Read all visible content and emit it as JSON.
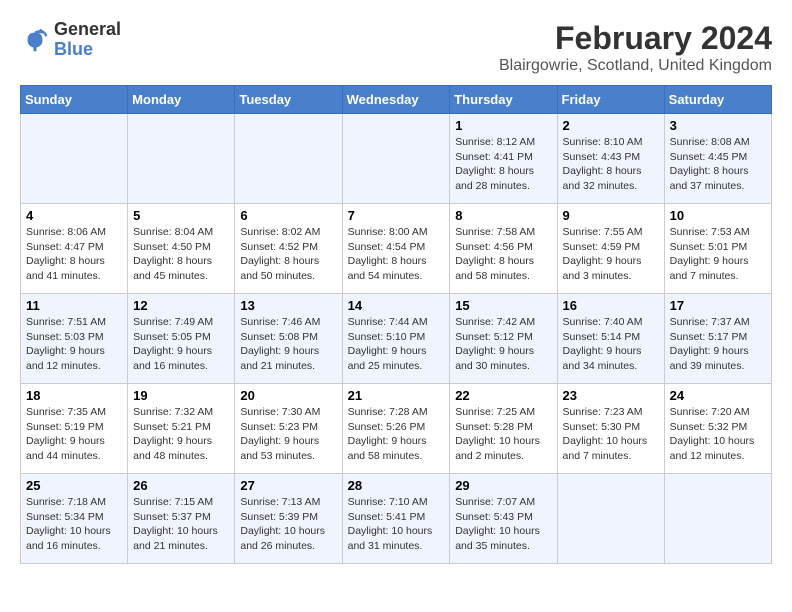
{
  "logo": {
    "line1": "General",
    "line2": "Blue"
  },
  "title": "February 2024",
  "subtitle": "Blairgowrie, Scotland, United Kingdom",
  "days_of_week": [
    "Sunday",
    "Monday",
    "Tuesday",
    "Wednesday",
    "Thursday",
    "Friday",
    "Saturday"
  ],
  "weeks": [
    [
      {
        "day": "",
        "sunrise": "",
        "sunset": "",
        "daylight": ""
      },
      {
        "day": "",
        "sunrise": "",
        "sunset": "",
        "daylight": ""
      },
      {
        "day": "",
        "sunrise": "",
        "sunset": "",
        "daylight": ""
      },
      {
        "day": "",
        "sunrise": "",
        "sunset": "",
        "daylight": ""
      },
      {
        "day": "1",
        "sunrise": "Sunrise: 8:12 AM",
        "sunset": "Sunset: 4:41 PM",
        "daylight": "Daylight: 8 hours and 28 minutes."
      },
      {
        "day": "2",
        "sunrise": "Sunrise: 8:10 AM",
        "sunset": "Sunset: 4:43 PM",
        "daylight": "Daylight: 8 hours and 32 minutes."
      },
      {
        "day": "3",
        "sunrise": "Sunrise: 8:08 AM",
        "sunset": "Sunset: 4:45 PM",
        "daylight": "Daylight: 8 hours and 37 minutes."
      }
    ],
    [
      {
        "day": "4",
        "sunrise": "Sunrise: 8:06 AM",
        "sunset": "Sunset: 4:47 PM",
        "daylight": "Daylight: 8 hours and 41 minutes."
      },
      {
        "day": "5",
        "sunrise": "Sunrise: 8:04 AM",
        "sunset": "Sunset: 4:50 PM",
        "daylight": "Daylight: 8 hours and 45 minutes."
      },
      {
        "day": "6",
        "sunrise": "Sunrise: 8:02 AM",
        "sunset": "Sunset: 4:52 PM",
        "daylight": "Daylight: 8 hours and 50 minutes."
      },
      {
        "day": "7",
        "sunrise": "Sunrise: 8:00 AM",
        "sunset": "Sunset: 4:54 PM",
        "daylight": "Daylight: 8 hours and 54 minutes."
      },
      {
        "day": "8",
        "sunrise": "Sunrise: 7:58 AM",
        "sunset": "Sunset: 4:56 PM",
        "daylight": "Daylight: 8 hours and 58 minutes."
      },
      {
        "day": "9",
        "sunrise": "Sunrise: 7:55 AM",
        "sunset": "Sunset: 4:59 PM",
        "daylight": "Daylight: 9 hours and 3 minutes."
      },
      {
        "day": "10",
        "sunrise": "Sunrise: 7:53 AM",
        "sunset": "Sunset: 5:01 PM",
        "daylight": "Daylight: 9 hours and 7 minutes."
      }
    ],
    [
      {
        "day": "11",
        "sunrise": "Sunrise: 7:51 AM",
        "sunset": "Sunset: 5:03 PM",
        "daylight": "Daylight: 9 hours and 12 minutes."
      },
      {
        "day": "12",
        "sunrise": "Sunrise: 7:49 AM",
        "sunset": "Sunset: 5:05 PM",
        "daylight": "Daylight: 9 hours and 16 minutes."
      },
      {
        "day": "13",
        "sunrise": "Sunrise: 7:46 AM",
        "sunset": "Sunset: 5:08 PM",
        "daylight": "Daylight: 9 hours and 21 minutes."
      },
      {
        "day": "14",
        "sunrise": "Sunrise: 7:44 AM",
        "sunset": "Sunset: 5:10 PM",
        "daylight": "Daylight: 9 hours and 25 minutes."
      },
      {
        "day": "15",
        "sunrise": "Sunrise: 7:42 AM",
        "sunset": "Sunset: 5:12 PM",
        "daylight": "Daylight: 9 hours and 30 minutes."
      },
      {
        "day": "16",
        "sunrise": "Sunrise: 7:40 AM",
        "sunset": "Sunset: 5:14 PM",
        "daylight": "Daylight: 9 hours and 34 minutes."
      },
      {
        "day": "17",
        "sunrise": "Sunrise: 7:37 AM",
        "sunset": "Sunset: 5:17 PM",
        "daylight": "Daylight: 9 hours and 39 minutes."
      }
    ],
    [
      {
        "day": "18",
        "sunrise": "Sunrise: 7:35 AM",
        "sunset": "Sunset: 5:19 PM",
        "daylight": "Daylight: 9 hours and 44 minutes."
      },
      {
        "day": "19",
        "sunrise": "Sunrise: 7:32 AM",
        "sunset": "Sunset: 5:21 PM",
        "daylight": "Daylight: 9 hours and 48 minutes."
      },
      {
        "day": "20",
        "sunrise": "Sunrise: 7:30 AM",
        "sunset": "Sunset: 5:23 PM",
        "daylight": "Daylight: 9 hours and 53 minutes."
      },
      {
        "day": "21",
        "sunrise": "Sunrise: 7:28 AM",
        "sunset": "Sunset: 5:26 PM",
        "daylight": "Daylight: 9 hours and 58 minutes."
      },
      {
        "day": "22",
        "sunrise": "Sunrise: 7:25 AM",
        "sunset": "Sunset: 5:28 PM",
        "daylight": "Daylight: 10 hours and 2 minutes."
      },
      {
        "day": "23",
        "sunrise": "Sunrise: 7:23 AM",
        "sunset": "Sunset: 5:30 PM",
        "daylight": "Daylight: 10 hours and 7 minutes."
      },
      {
        "day": "24",
        "sunrise": "Sunrise: 7:20 AM",
        "sunset": "Sunset: 5:32 PM",
        "daylight": "Daylight: 10 hours and 12 minutes."
      }
    ],
    [
      {
        "day": "25",
        "sunrise": "Sunrise: 7:18 AM",
        "sunset": "Sunset: 5:34 PM",
        "daylight": "Daylight: 10 hours and 16 minutes."
      },
      {
        "day": "26",
        "sunrise": "Sunrise: 7:15 AM",
        "sunset": "Sunset: 5:37 PM",
        "daylight": "Daylight: 10 hours and 21 minutes."
      },
      {
        "day": "27",
        "sunrise": "Sunrise: 7:13 AM",
        "sunset": "Sunset: 5:39 PM",
        "daylight": "Daylight: 10 hours and 26 minutes."
      },
      {
        "day": "28",
        "sunrise": "Sunrise: 7:10 AM",
        "sunset": "Sunset: 5:41 PM",
        "daylight": "Daylight: 10 hours and 31 minutes."
      },
      {
        "day": "29",
        "sunrise": "Sunrise: 7:07 AM",
        "sunset": "Sunset: 5:43 PM",
        "daylight": "Daylight: 10 hours and 35 minutes."
      },
      {
        "day": "",
        "sunrise": "",
        "sunset": "",
        "daylight": ""
      },
      {
        "day": "",
        "sunrise": "",
        "sunset": "",
        "daylight": ""
      }
    ]
  ]
}
